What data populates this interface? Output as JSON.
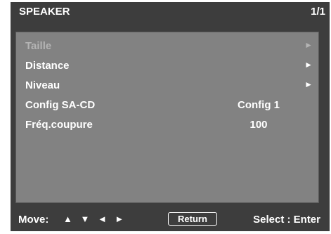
{
  "header": {
    "title": "SPEAKER",
    "page": "1/1"
  },
  "menu": {
    "items": [
      {
        "label": "Taille",
        "value": "",
        "arrow": "►",
        "state": "disabled"
      },
      {
        "label": "Distance",
        "value": "",
        "arrow": "►",
        "state": "enabled"
      },
      {
        "label": "Niveau",
        "value": "",
        "arrow": "►",
        "state": "enabled"
      },
      {
        "label": "Config SA-CD",
        "value": "Config 1",
        "arrow": "",
        "state": "enabled"
      },
      {
        "label": "Fréq.coupure",
        "value": "100",
        "arrow": "",
        "state": "enabled"
      }
    ]
  },
  "footer": {
    "move_label": "Move:",
    "move_arrows": "▲ ▼ ◄ ►",
    "return_label": "Return",
    "select_hint": "Select : Enter"
  },
  "colors": {
    "osd_background": "#3d3d3d",
    "panel_background": "#828282",
    "text": "#ffffff",
    "disabled_text": "#b4b4b4"
  },
  "icons": {
    "submenu_arrow": "right-triangle-icon",
    "move_arrows": "direction-arrows-icon"
  }
}
